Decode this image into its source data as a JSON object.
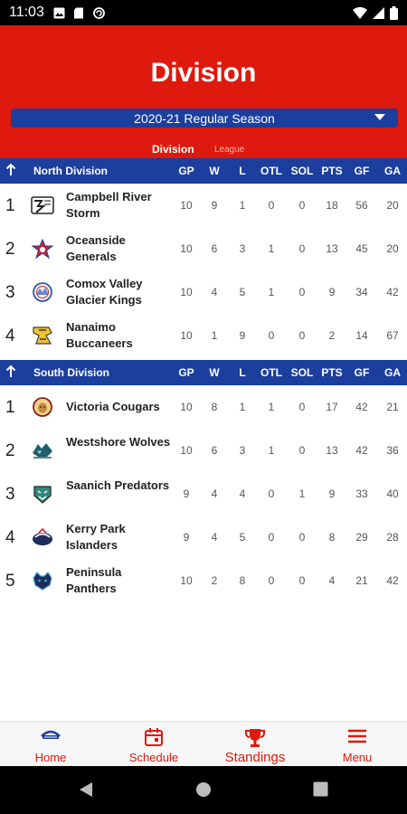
{
  "status_bar": {
    "time": "11:03"
  },
  "header": {
    "title": "Division",
    "season": "2020-21 Regular Season",
    "tabs": {
      "division": "Division",
      "league": "League"
    }
  },
  "columns": {
    "gp": "GP",
    "w": "W",
    "l": "L",
    "otl": "OTL",
    "sol": "SOL",
    "pts": "PTS",
    "gf": "GF",
    "ga": "GA"
  },
  "north": {
    "name": "North Division",
    "rows": [
      {
        "rank": "1",
        "team": "Campbell River Storm",
        "gp": "10",
        "w": "9",
        "l": "1",
        "otl": "0",
        "sol": "0",
        "pts": "18",
        "gf": "56",
        "ga": "20"
      },
      {
        "rank": "2",
        "team": "Oceanside Generals",
        "gp": "10",
        "w": "6",
        "l": "3",
        "otl": "1",
        "sol": "0",
        "pts": "13",
        "gf": "45",
        "ga": "20"
      },
      {
        "rank": "3",
        "team": "Comox Valley Glacier Kings",
        "gp": "10",
        "w": "4",
        "l": "5",
        "otl": "1",
        "sol": "0",
        "pts": "9",
        "gf": "34",
        "ga": "42"
      },
      {
        "rank": "4",
        "team": "Nanaimo Buccaneers",
        "gp": "10",
        "w": "1",
        "l": "9",
        "otl": "0",
        "sol": "0",
        "pts": "2",
        "gf": "14",
        "ga": "67"
      }
    ]
  },
  "south": {
    "name": "South Division",
    "rows": [
      {
        "rank": "1",
        "team": "Victoria Cougars",
        "gp": "10",
        "w": "8",
        "l": "1",
        "otl": "1",
        "sol": "0",
        "pts": "17",
        "gf": "42",
        "ga": "21"
      },
      {
        "rank": "2",
        "team": "Westshore Wolves",
        "gp": "10",
        "w": "6",
        "l": "3",
        "otl": "1",
        "sol": "0",
        "pts": "13",
        "gf": "42",
        "ga": "36"
      },
      {
        "rank": "3",
        "team": "Saanich Predators",
        "gp": "9",
        "w": "4",
        "l": "4",
        "otl": "0",
        "sol": "1",
        "pts": "9",
        "gf": "33",
        "ga": "40"
      },
      {
        "rank": "4",
        "team": "Kerry Park Islanders",
        "gp": "9",
        "w": "4",
        "l": "5",
        "otl": "0",
        "sol": "0",
        "pts": "8",
        "gf": "29",
        "ga": "28"
      },
      {
        "rank": "5",
        "team": "Peninsula Panthers",
        "gp": "10",
        "w": "2",
        "l": "8",
        "otl": "0",
        "sol": "0",
        "pts": "4",
        "gf": "21",
        "ga": "42"
      }
    ]
  },
  "bottom_nav": {
    "home": "Home",
    "schedule": "Schedule",
    "standings": "Standings",
    "menu": "Menu"
  },
  "colors": {
    "brand_red": "#dd1a0d",
    "division_blue": "#1c3e9d"
  }
}
